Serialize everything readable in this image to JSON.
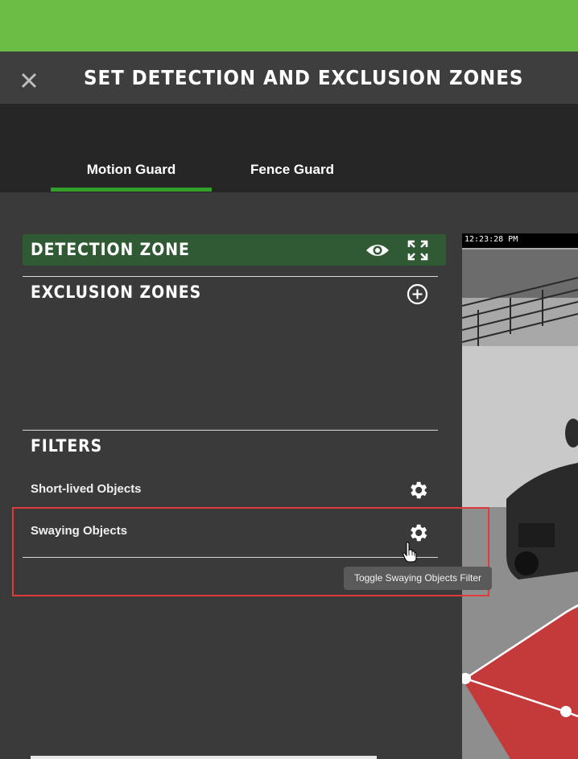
{
  "header": {
    "title": "SET DETECTION AND EXCLUSION ZONES",
    "close_icon": "close-icon",
    "accent_color": "#6cbd45"
  },
  "tabs": [
    {
      "label": "Motion Guard",
      "active": true
    },
    {
      "label": "Fence Guard",
      "active": false
    }
  ],
  "detection_zone": {
    "title": "DETECTION ZONE",
    "icons": [
      "eye-icon",
      "expand-icon"
    ],
    "background": "#2f5a33"
  },
  "exclusion_zones": {
    "title": "EXCLUSION ZONES",
    "icon": "add-circle-icon"
  },
  "filters": {
    "title": "FILTERS",
    "items": [
      {
        "label": "Short-lived Objects",
        "icon": "gear-icon"
      },
      {
        "label": "Swaying Objects",
        "icon": "gear-icon"
      }
    ],
    "tooltip": "Toggle Swaying Objects Filter"
  },
  "camera": {
    "timestamp": "12:23:28 PM"
  }
}
